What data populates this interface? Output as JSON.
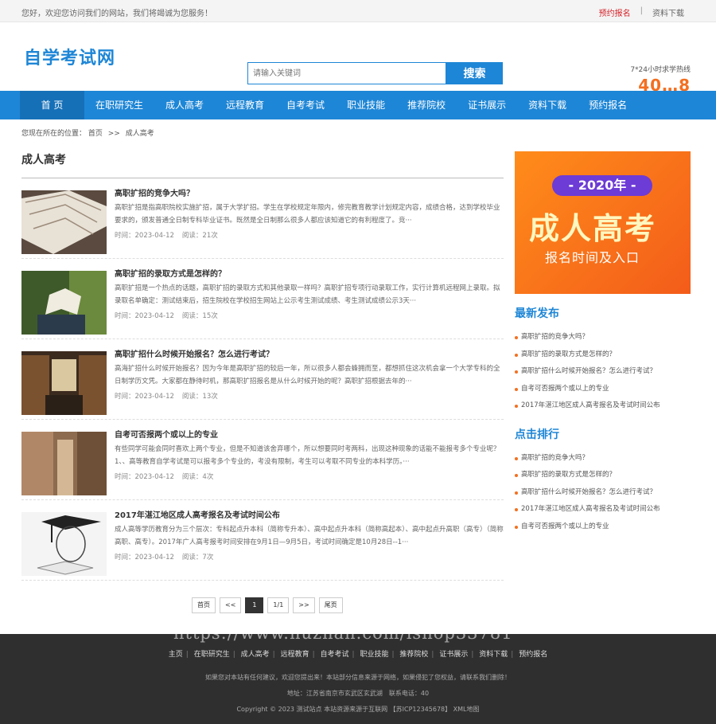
{
  "topbar": {
    "welcome": "您好，欢迎您访问我们的网站，我们将竭诚为您服务！",
    "link1": "预约报名",
    "sep": "|",
    "link2": "资料下载"
  },
  "header": {
    "logo": "自学考试网",
    "search_placeholder": "请输入关键词",
    "search_button": "搜索",
    "hotline_label": "7*24小时求学热线",
    "hotline_number": "40…8"
  },
  "nav": {
    "items": [
      "首 页",
      "在职研究生",
      "成人高考",
      "远程教育",
      "自考考试",
      "职业技能",
      "推荐院校",
      "证书展示",
      "资料下载",
      "预约报名"
    ]
  },
  "breadcrumb": {
    "prefix": "您现在所在的位置：",
    "home": "首页",
    "arrow": ">>",
    "current": "成人高考"
  },
  "main": {
    "heading": "成人高考",
    "articles": [
      {
        "title": "高职扩招的竞争大吗？",
        "desc": "高职扩招是指高职院校实施扩招，属于大学扩招。学生在学校规定年限内，修完教育教学计划规定内容，成绩合格，达到学校毕业要求的，颁发普通全日制专科毕业证书。既然是全日制那么很多人都应该知道它的有利程度了。竞···",
        "time": "时间：2023-04-12",
        "reads": "阅读：21次"
      },
      {
        "title": "高职扩招的录取方式是怎样的？",
        "desc": "高职扩招是一个热点的话题，高职扩招的录取方式和其他录取一样吗？高职扩招专项行动录取工作，实行计算机远程网上录取。拟录取名单确定：测试结束后，招生院校在学校招生网站上公示考生测试成绩、考生测试成绩公示3天···",
        "time": "时间：2023-04-12",
        "reads": "阅读：15次"
      },
      {
        "title": "高职扩招什么时候开始报名？怎么进行考试？",
        "desc": "高海扩招什么时候开始报名？因为今年是高职扩招的较后一年，所以很多人都会蜂拥而至，都想抓住这次机会拿一个大学专科的全日制学历文凭。大家都在静待时机，那高职扩招报名是从什么时候开始的呢？高职扩招根据去年的···",
        "time": "时间：2023-04-12",
        "reads": "阅读：13次"
      },
      {
        "title": "自考可否报两个或以上的专业",
        "desc": "有些同学可能会同时喜欢上两个专业，但是不知道该舍弃哪个，所以想要同时考两科，出现这种现象的话能不能报考多个专业呢？1、、高等教育自学考试是可以报考多个专业的，考没有限制，考生可以考取不同专业的本科学历。···",
        "time": "时间：2023-04-12",
        "reads": "阅读：4次"
      },
      {
        "title": "2017年湛江地区成人高考报名及考试时间公布",
        "desc": "成人高等学历教育分为三个层次：专科起点升本科（简称专升本）、高中起点升本科（简称高起本）、高中起点升高职（高专）（简称高职、高专）。2017年广人高考报考时间安排在9月1日—9月5日，考试时间确定是10月28日--1···",
        "time": "时间：2023-04-12",
        "reads": "阅读：7次"
      }
    ]
  },
  "pager": {
    "first": "首页",
    "prev": "<<",
    "current": "1",
    "total": "1/1",
    "next": ">>",
    "last": "尾页"
  },
  "side": {
    "banner": {
      "year": "- 2020年 -",
      "big": "成人高考",
      "sub": "报名时间及入口"
    },
    "latest_title": "最新发布",
    "latest": [
      "高职扩招的竞争大吗？",
      "高职扩招的录取方式是怎样的？",
      "高职扩招什么时候开始报名？怎么进行考试？",
      "自考可否报两个或以上的专业",
      "2017年湛江地区成人高考报名及考试时间公布"
    ],
    "rank_title": "点击排行",
    "rank": [
      "高职扩招的竞争大吗？",
      "高职扩招的录取方式是怎样的？",
      "高职扩招什么时候开始报名？怎么进行考试？",
      "2017年湛江地区成人高考报名及考试时间公布",
      "自考可否报两个或以上的专业"
    ]
  },
  "footer": {
    "nav": [
      "主页",
      "在职研究生",
      "成人高考",
      "远程教育",
      "自考考试",
      "职业技能",
      "推荐院校",
      "证书展示",
      "资料下载",
      "预约报名"
    ],
    "notice": "如果您对本站有任何建议，欢迎您提出来！本站部分信息来源于网络，如果侵犯了您权益，请联系我们删除！",
    "address": "地址：江苏省南京市玄武区玄武湖　联系电话：40",
    "copyright": "Copyright © 2023 测试站点 本站资源来源于互联网 【苏ICP12345678】 XML地图"
  },
  "watermark": "https://www.huzhan.com/ishop33781"
}
